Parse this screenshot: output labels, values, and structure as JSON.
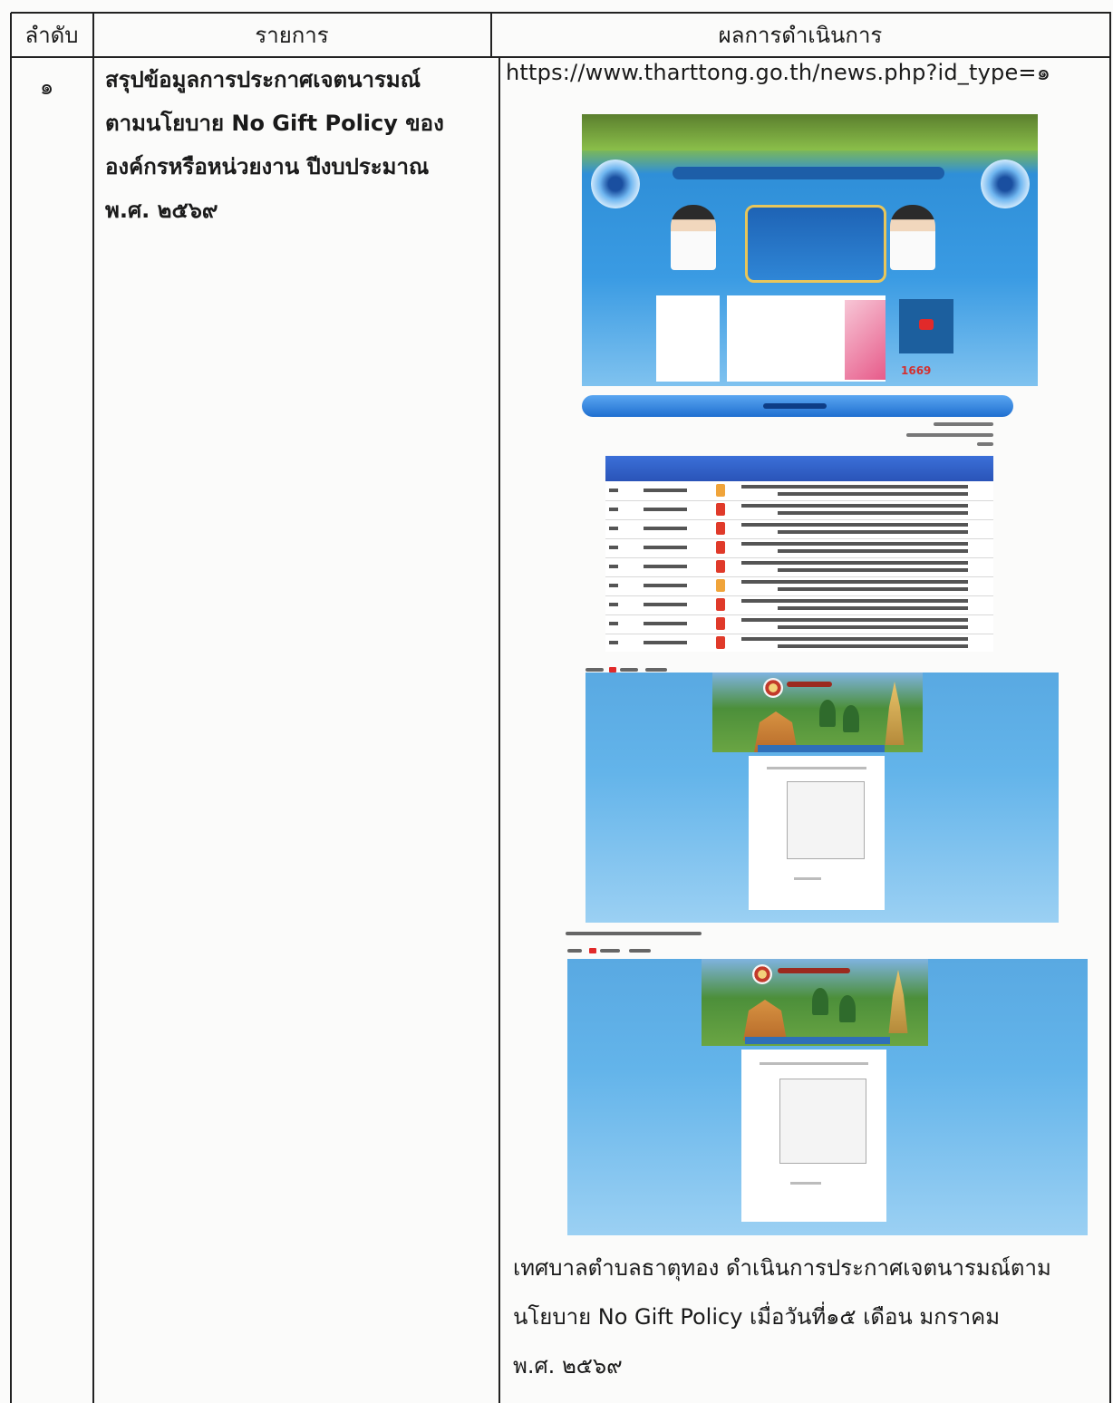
{
  "table": {
    "headers": {
      "col1": "ลำดับ",
      "col2": "รายการ",
      "col3": "ผลการดำเนินการ"
    },
    "rows": [
      {
        "number": "๑",
        "item_lines": [
          "สรุปข้อมูลการประกาศเจตนารมณ์",
          "ตามนโยบาย No Gift Policy ของ",
          "องค์กรหรือหน่วยงาน ปีงบประมาณ",
          "พ.ศ. ๒๕๖๙"
        ],
        "result_url": "https://www.tharttong.go.th/news.php?id_type=๑",
        "screenshots": [
          {
            "name": "homepage-screenshot",
            "highlight_number": "1669"
          },
          {
            "name": "announcement-list-screenshot"
          },
          {
            "name": "announcement-document-screenshot-1"
          },
          {
            "name": "announcement-document-screenshot-2"
          }
        ],
        "result_caption_lines": [
          "เทศบาลตำบลธาตุทอง ดำเนินการประกาศเจตนารมณ์ตาม",
          "นโยบาย No Gift Policy เมื่อวันที่๑๕ เดือน มกราคม",
          "พ.ศ. ๒๕๖๙"
        ]
      }
    ]
  }
}
